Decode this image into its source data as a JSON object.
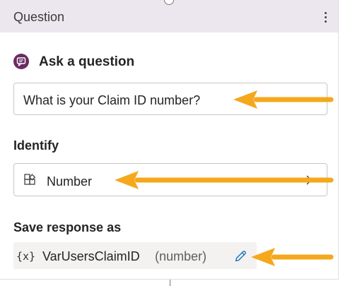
{
  "card": {
    "title": "Question",
    "more_options_icon": "more-vertical-icon"
  },
  "ask": {
    "icon": "chat-bubble-icon",
    "label": "Ask a question",
    "question_text": "What is your Claim ID number?"
  },
  "identify": {
    "label": "Identify",
    "icon": "entity-shapes-icon",
    "value": "Number",
    "chevron": "chevron-right-icon"
  },
  "save": {
    "label": "Save response as",
    "variable_symbol": "{x}",
    "variable_name": "VarUsersClaimID",
    "variable_type": "(number)",
    "edit_icon": "pencil-icon"
  },
  "colors": {
    "header_bg": "#ece7ef",
    "ask_icon": "#6a2c64",
    "arrow": "#f5a81c",
    "accent_blue": "#0f6cbd"
  }
}
